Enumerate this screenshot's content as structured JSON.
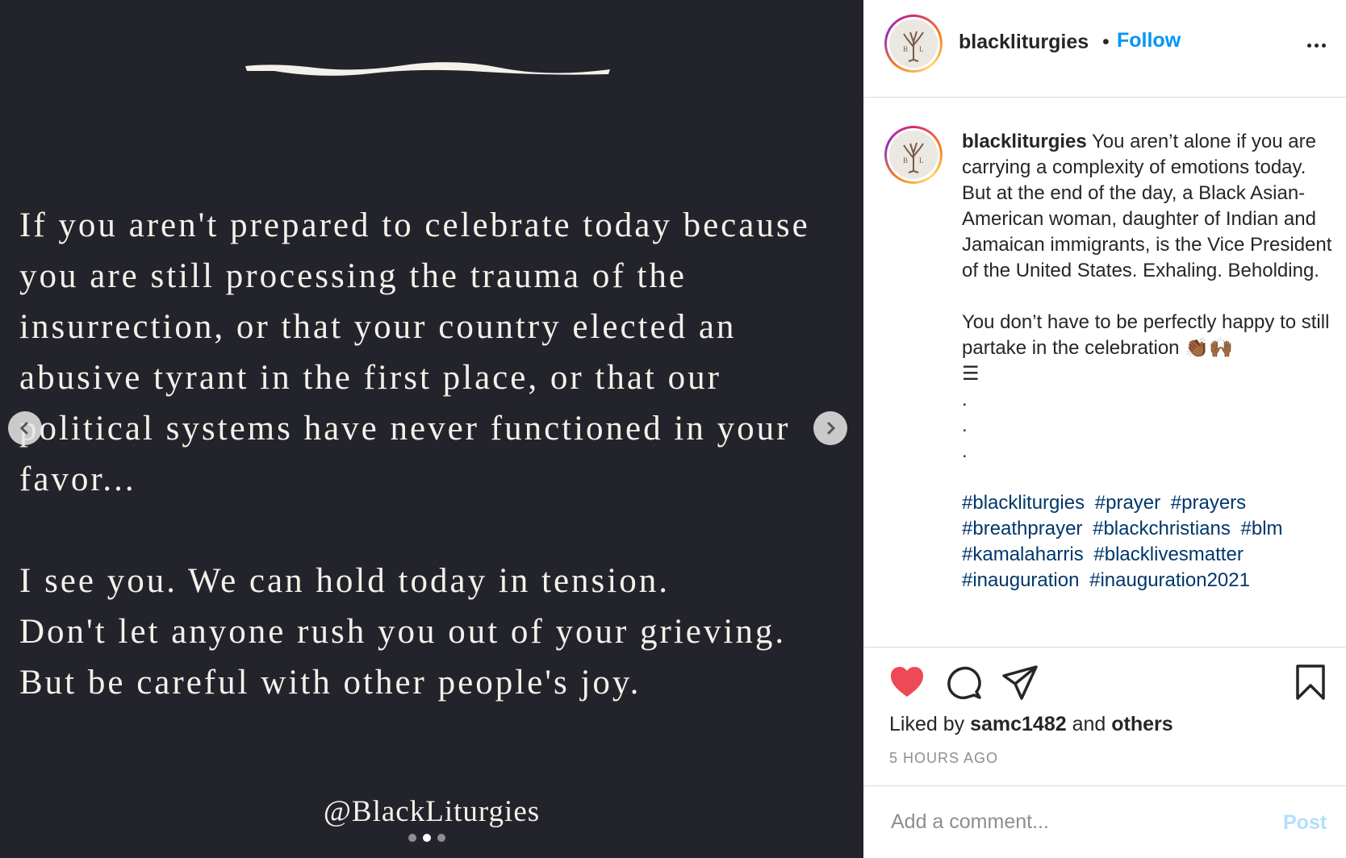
{
  "media": {
    "quote_lines": [
      "If you aren't prepared to celebrate today because",
      "you are still processing the trauma of the",
      "insurrection, or that your country elected an",
      "abusive tyrant in the first place, or that our",
      "political systems have never functioned in your",
      "favor..."
    ],
    "closing_lines": [
      "I see you. We can hold today in tension.",
      "Don't let anyone rush you out of your grieving.",
      "But be careful with other people's joy."
    ],
    "handle": "@BlackLiturgies",
    "carousel": {
      "count": 3,
      "active": 2
    }
  },
  "header": {
    "username": "blackliturgies",
    "separator": "•",
    "follow_label": "Follow"
  },
  "caption": {
    "username": "blackliturgies",
    "text": "You aren’t alone if you are carrying a complexity of emotions today. But at the end of the day, a Black Asian-American woman, daughter of Indian and Jamaican immigrants, is the Vice President of the United States. Exhaling. Beholding.",
    "text2": "You don’t have to be perfectly happy to still partake in the celebration 👏🏾🙌🏾",
    "flag": "☰",
    "dots": [
      ".",
      ".",
      "."
    ],
    "hashtags": [
      "#blackliturgies",
      "#prayer",
      "#prayers",
      "#breathprayer",
      "#blackchristians",
      "#blm",
      "#kamalaharris",
      "#blacklivesmatter",
      "#inauguration",
      "#inauguration2021"
    ]
  },
  "likes": {
    "prefix": "Liked by",
    "user": "samc1482",
    "conj": "and",
    "others": "others"
  },
  "time": "5 HOURS AGO",
  "comment": {
    "placeholder": "Add a comment...",
    "post_label": "Post"
  },
  "colors": {
    "media_bg": "#23242b",
    "like_red": "#ed4956",
    "follow_blue": "#0095f6",
    "hashtag": "#00376b"
  }
}
